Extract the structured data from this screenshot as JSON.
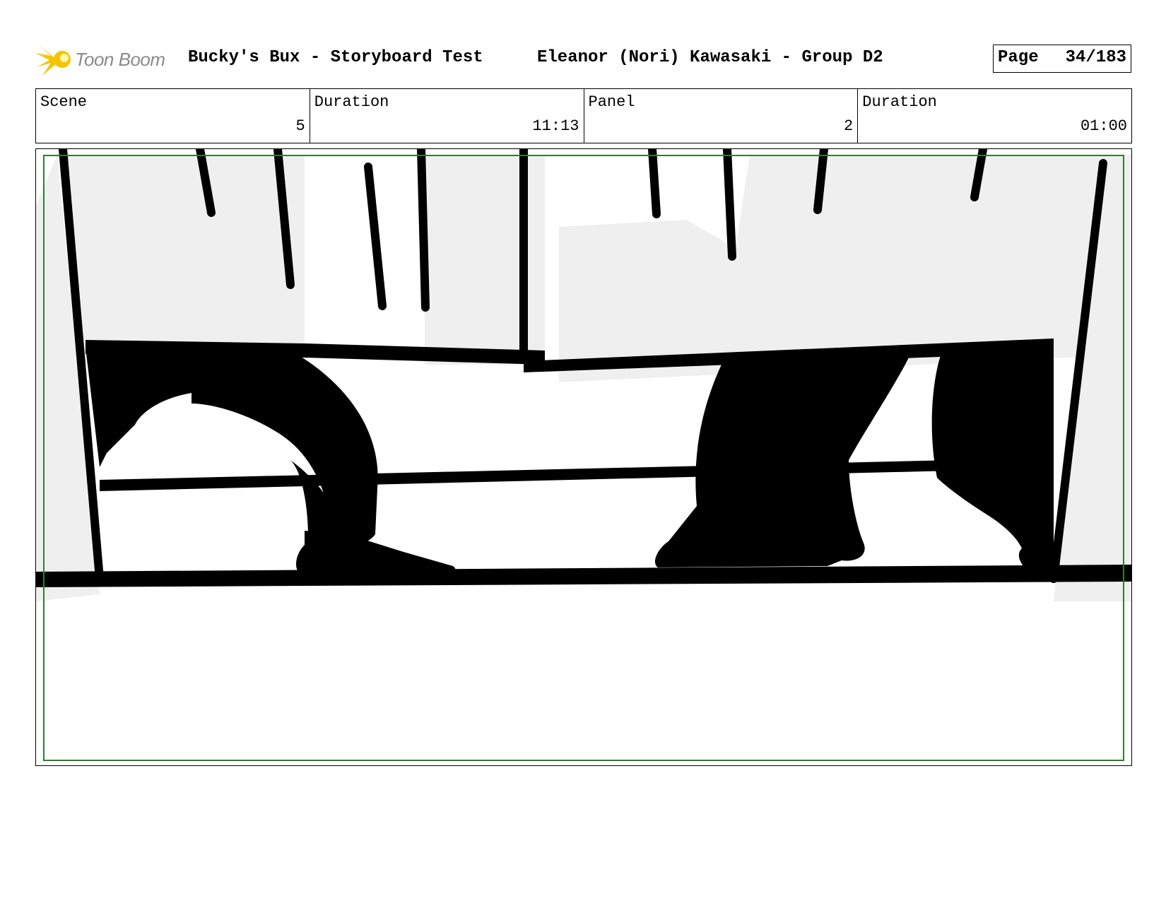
{
  "header": {
    "logo_text": "Toon Boom",
    "project_title": "Bucky's Bux - Storyboard Test",
    "artist": "Eleanor (Nori) Kawasaki - Group D2",
    "page_label": "Page",
    "page_number": "34/183"
  },
  "info": {
    "scene_label": "Scene",
    "scene_value": "5",
    "scene_duration_label": "Duration",
    "scene_duration_value": "11:13",
    "panel_label": "Panel",
    "panel_value": "2",
    "panel_duration_label": "Duration",
    "panel_duration_value": "01:00"
  },
  "colors": {
    "frame_green": "#2e7d32",
    "logo_yellow": "#f5c400",
    "drawing_black": "#000000",
    "wall_gray": "#efefef"
  },
  "icons": [
    "toon-boom-logo-icon"
  ]
}
